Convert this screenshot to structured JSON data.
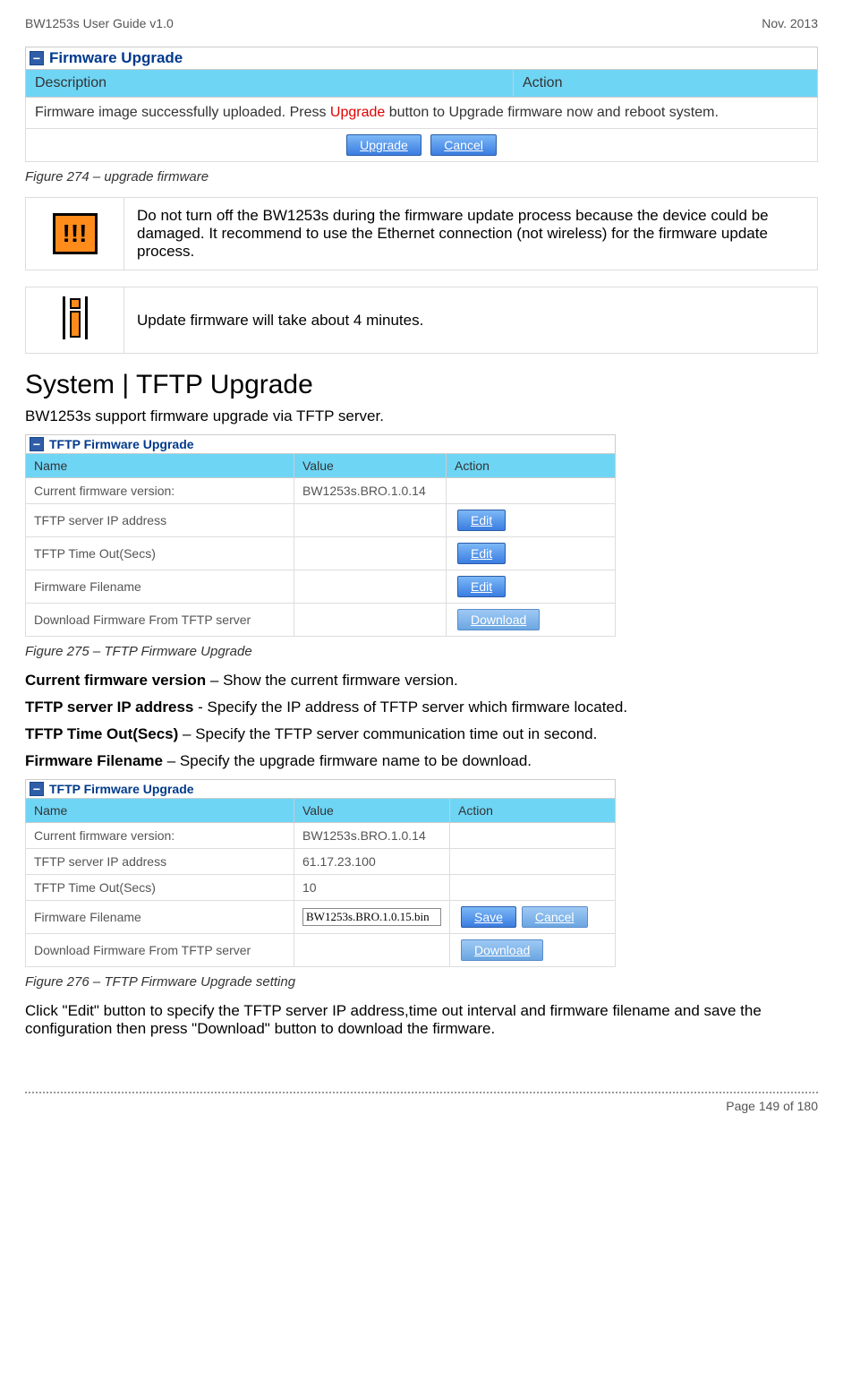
{
  "header": {
    "left": "BW1253s User Guide v1.0",
    "right": "Nov.  2013"
  },
  "panel1": {
    "title": "Firmware Upgrade",
    "cols": {
      "c1": "Description",
      "c2": "Action"
    },
    "msg_pre": "Firmware image successfully uploaded. Press ",
    "msg_key": "Upgrade",
    "msg_post": " button to Upgrade firmware now and reboot system.",
    "btn1": "Upgrade",
    "btn2": "Cancel"
  },
  "fig274": "Figure 274 – upgrade firmware",
  "note1": "Do not turn off the BW1253s during the firmware update process because the device could be damaged. It recommend to use the Ethernet connection (not wireless) for the firmware update process.",
  "note2": "Update firmware will take about 4 minutes.",
  "section": "System | TFTP Upgrade",
  "intro": "BW1253s support firmware upgrade via TFTP server.",
  "panel2": {
    "title": "TFTP Firmware Upgrade",
    "cols": {
      "c1": "Name",
      "c2": "Value",
      "c3": "Action"
    },
    "rows": {
      "r1": {
        "n": "Current firmware version:",
        "v": "BW1253s.BRO.1.0.14",
        "a": ""
      },
      "r2": {
        "n": "TFTP server IP address",
        "v": "",
        "a": "Edit"
      },
      "r3": {
        "n": "TFTP Time Out(Secs)",
        "v": "",
        "a": "Edit"
      },
      "r4": {
        "n": "Firmware Filename",
        "v": "",
        "a": "Edit"
      },
      "r5": {
        "n": "Download Firmware From TFTP server",
        "v": "",
        "a": "Download"
      }
    }
  },
  "fig275": "Figure 275 – TFTP Firmware Upgrade",
  "desc": {
    "d1": {
      "b": "Current firmware version",
      "t": " – Show the current firmware version."
    },
    "d2": {
      "b": "TFTP server IP address",
      "t": " -  Specify the IP address of TFTP server which firmware located."
    },
    "d3": {
      "b": "TFTP Time Out(Secs)",
      "t": " – Specify the TFTP server communication time out in second."
    },
    "d4": {
      "b": "Firmware Filename",
      "t": " – Specify the upgrade firmware name to be download."
    }
  },
  "panel3": {
    "title": "TFTP Firmware Upgrade",
    "cols": {
      "c1": "Name",
      "c2": "Value",
      "c3": "Action"
    },
    "rows": {
      "r1": {
        "n": "Current firmware version:",
        "v": "BW1253s.BRO.1.0.14"
      },
      "r2": {
        "n": "TFTP server IP address",
        "v": "61.17.23.100"
      },
      "r3": {
        "n": "TFTP Time Out(Secs)",
        "v": "10"
      },
      "r4": {
        "n": "Firmware Filename",
        "v": "BW1253s.BRO.1.0.15.bin",
        "a1": "Save",
        "a2": "Cancel"
      },
      "r5": {
        "n": "Download Firmware From TFTP server",
        "a": "Download"
      }
    }
  },
  "fig276": "Figure 276 – TFTP Firmware Upgrade setting",
  "outro": "Click \"Edit\" button to specify the TFTP server IP address,time out interval and firmware filename and save the configuration then press \"Download\" button to download the firmware.",
  "pageno": "Page 149 of 180"
}
